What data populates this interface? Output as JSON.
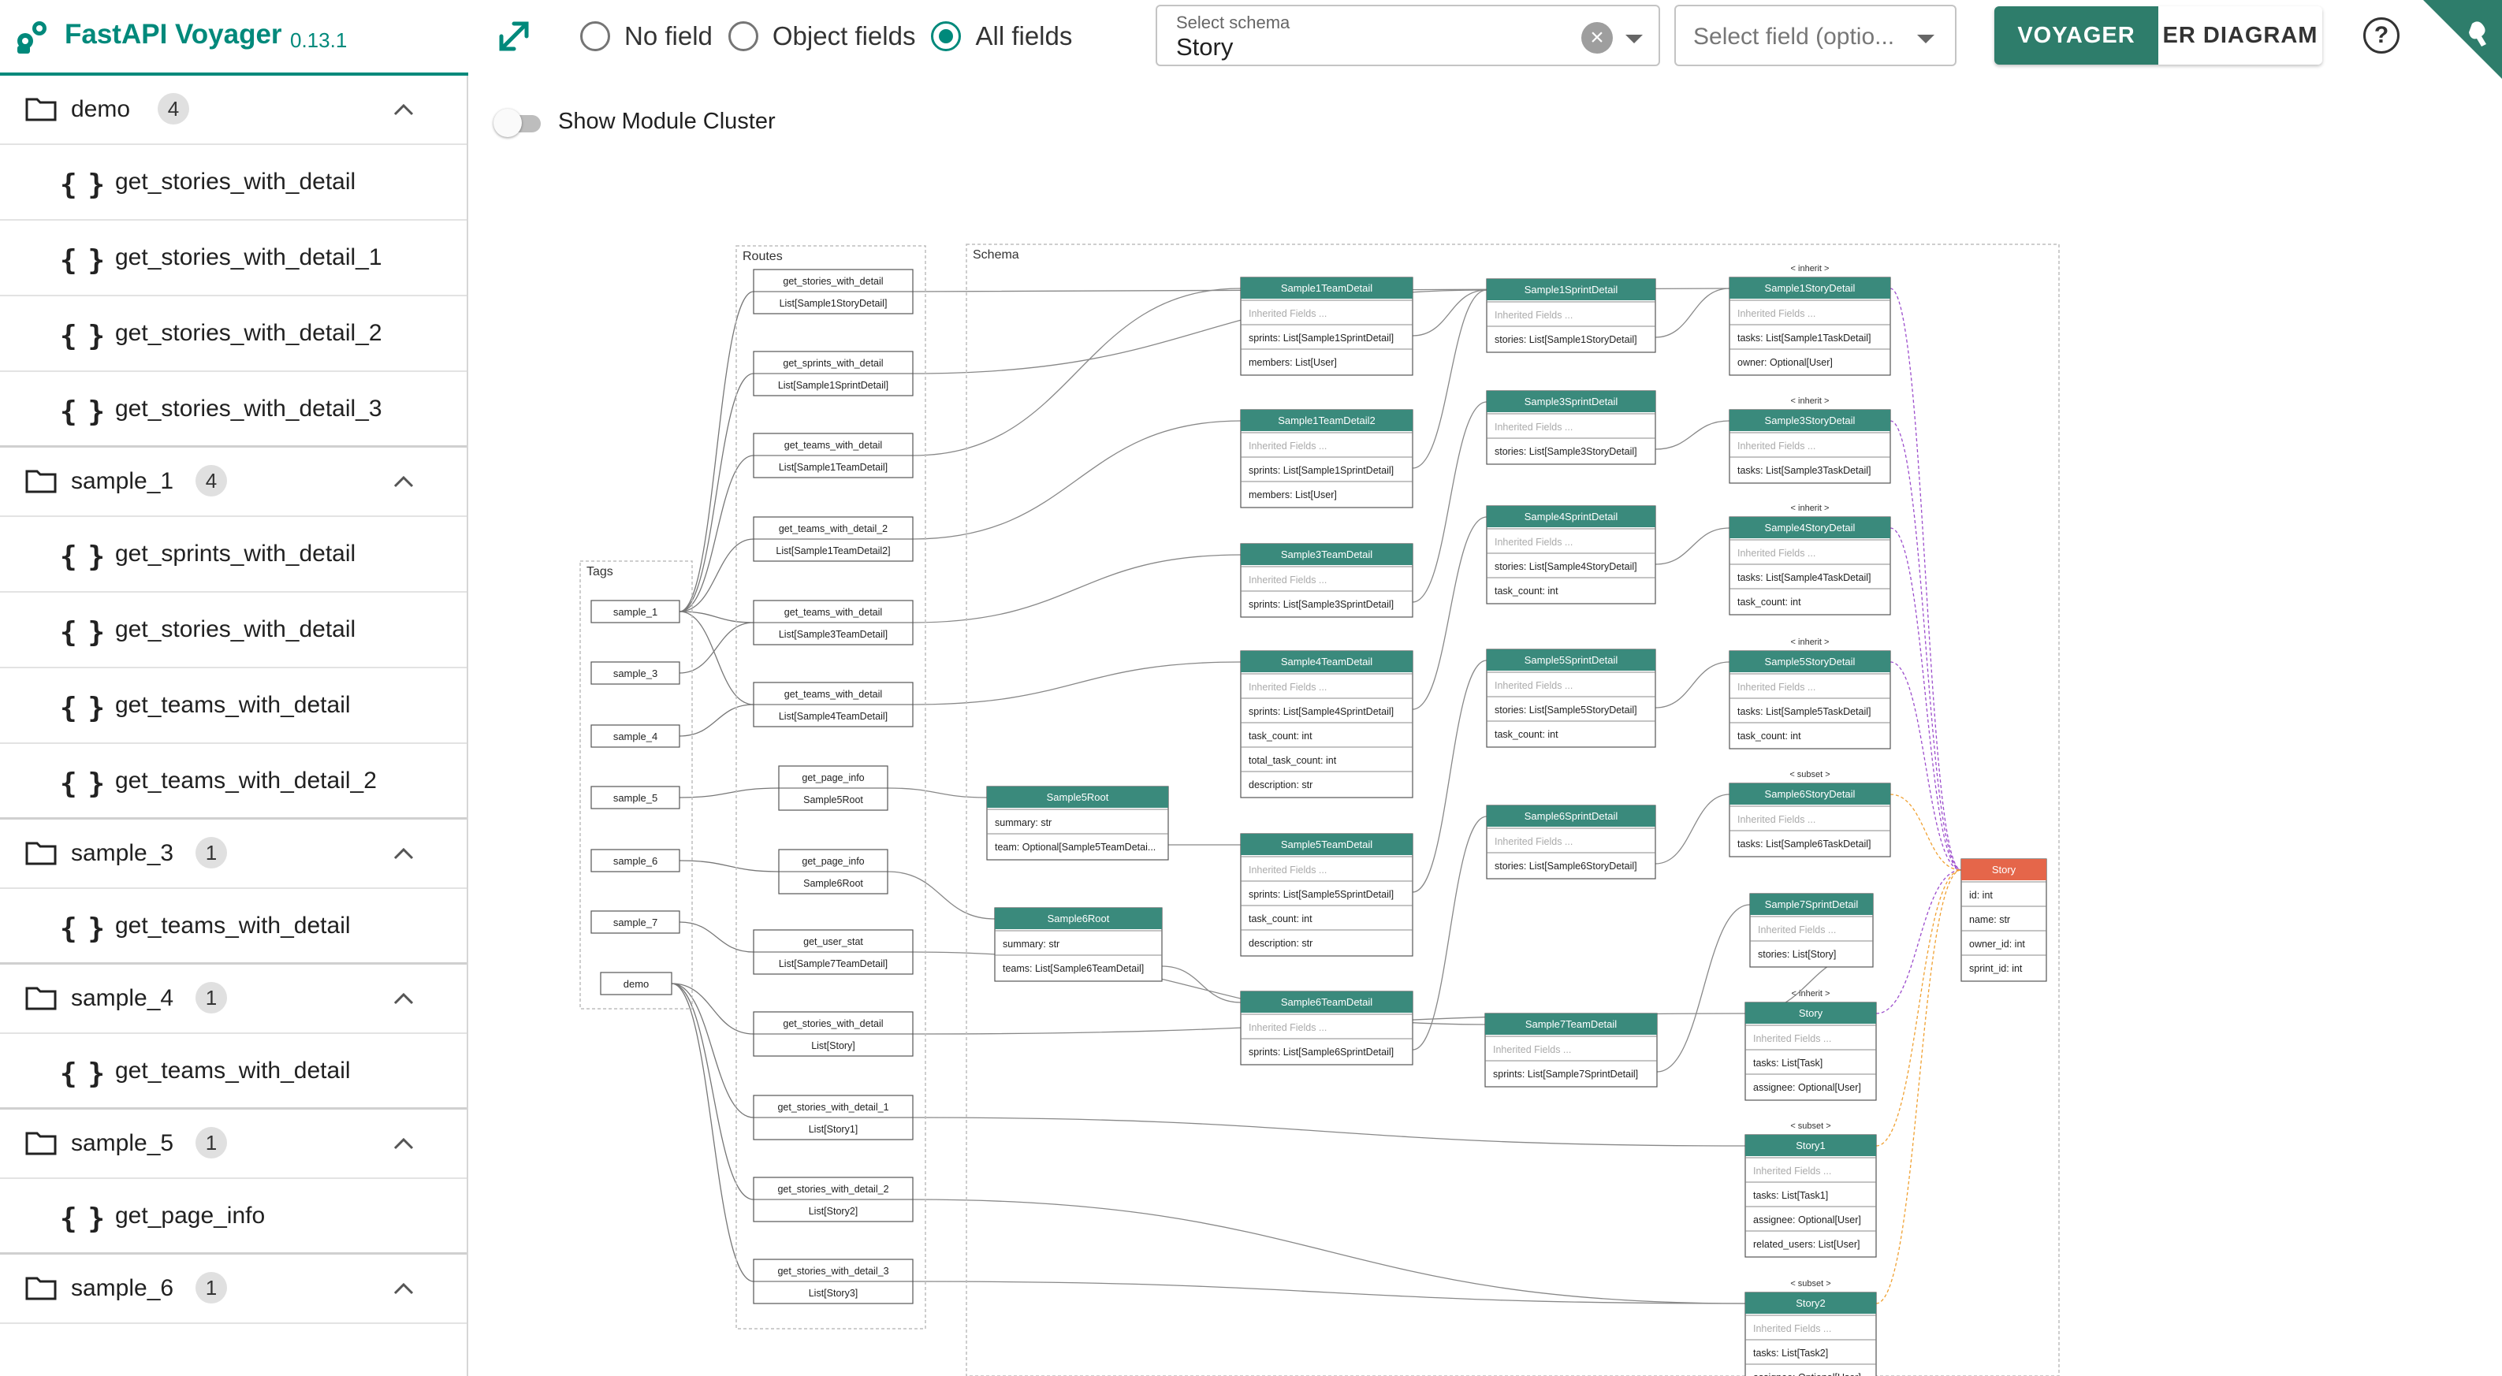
{
  "header": {
    "app_title": "FastAPI Voyager",
    "version": "0.13.1",
    "field_mode_options": [
      "No field",
      "Object fields",
      "All fields"
    ],
    "field_mode_selected": "All fields",
    "schema_select": {
      "label": "Select schema",
      "value": "Story"
    },
    "field_select": {
      "placeholder": "Select field (optio..."
    },
    "view_tabs": [
      {
        "label": "VOYAGER",
        "active": true
      },
      {
        "label": "ER DIAGRAM",
        "active": false
      }
    ],
    "colors": {
      "brand": "#00897b",
      "node_header": "#3a8a7c",
      "target_node": "#e5664a"
    }
  },
  "sidebar": {
    "groups": [
      {
        "name": "demo",
        "count": "4",
        "routes": [
          "get_stories_with_detail",
          "get_stories_with_detail_1",
          "get_stories_with_detail_2",
          "get_stories_with_detail_3"
        ]
      },
      {
        "name": "sample_1",
        "count": "4",
        "routes": [
          "get_sprints_with_detail",
          "get_stories_with_detail",
          "get_teams_with_detail",
          "get_teams_with_detail_2"
        ]
      },
      {
        "name": "sample_3",
        "count": "1",
        "routes": [
          "get_teams_with_detail"
        ]
      },
      {
        "name": "sample_4",
        "count": "1",
        "routes": [
          "get_teams_with_detail"
        ]
      },
      {
        "name": "sample_5",
        "count": "1",
        "routes": [
          "get_page_info"
        ]
      },
      {
        "name": "sample_6",
        "count": "1",
        "routes": []
      }
    ]
  },
  "canvas": {
    "show_module_cluster_label": "Show Module Cluster",
    "clusters": {
      "tags": "Tags",
      "routes": "Routes",
      "schema": "Schema"
    },
    "tags": [
      "sample_1",
      "sample_3",
      "sample_4",
      "sample_5",
      "sample_6",
      "sample_7",
      "demo"
    ],
    "routes": [
      {
        "name": "get_stories_with_detail",
        "ret": "List[Sample1StoryDetail]"
      },
      {
        "name": "get_sprints_with_detail",
        "ret": "List[Sample1SprintDetail]"
      },
      {
        "name": "get_teams_with_detail",
        "ret": "List[Sample1TeamDetail]"
      },
      {
        "name": "get_teams_with_detail_2",
        "ret": "List[Sample1TeamDetail2]"
      },
      {
        "name": "get_teams_with_detail",
        "ret": "List[Sample3TeamDetail]"
      },
      {
        "name": "get_teams_with_detail",
        "ret": "List[Sample4TeamDetail]"
      },
      {
        "name": "get_page_info",
        "ret": "Sample5Root"
      },
      {
        "name": "get_page_info",
        "ret": "Sample6Root"
      },
      {
        "name": "get_user_stat",
        "ret": "List[Sample7TeamDetail]"
      },
      {
        "name": "get_stories_with_detail",
        "ret": "List[Story]"
      },
      {
        "name": "get_stories_with_detail_1",
        "ret": "List[Story1]"
      },
      {
        "name": "get_stories_with_detail_2",
        "ret": "List[Story2]"
      },
      {
        "name": "get_stories_with_detail_3",
        "ret": "List[Story3]"
      }
    ],
    "schemas": [
      {
        "id": "s5root",
        "title": "Sample5Root",
        "fields": [
          "summary: str",
          "team: Optional[Sample5TeamDetai..."
        ]
      },
      {
        "id": "s6root",
        "title": "Sample6Root",
        "fields": [
          "summary: str",
          "teams: List[Sample6TeamDetail]"
        ]
      },
      {
        "id": "t1",
        "title": "Sample1TeamDetail",
        "fields": [
          "Inherited Fields ...",
          "sprints: List[Sample1SprintDetail]",
          "members: List[User]"
        ]
      },
      {
        "id": "t1b",
        "title": "Sample1TeamDetail2",
        "fields": [
          "Inherited Fields ...",
          "sprints: List[Sample1SprintDetail]",
          "members: List[User]"
        ]
      },
      {
        "id": "t3",
        "title": "Sample3TeamDetail",
        "fields": [
          "Inherited Fields ...",
          "sprints: List[Sample3SprintDetail]"
        ]
      },
      {
        "id": "t4",
        "title": "Sample4TeamDetail",
        "fields": [
          "Inherited Fields ...",
          "sprints: List[Sample4SprintDetail]",
          "task_count: int",
          "total_task_count: int",
          "description: str"
        ]
      },
      {
        "id": "t5",
        "title": "Sample5TeamDetail",
        "fields": [
          "Inherited Fields ...",
          "sprints: List[Sample5SprintDetail]",
          "task_count: int",
          "description: str"
        ]
      },
      {
        "id": "t6",
        "title": "Sample6TeamDetail",
        "fields": [
          "Inherited Fields ...",
          "sprints: List[Sample6SprintDetail]"
        ]
      },
      {
        "id": "sp1",
        "title": "Sample1SprintDetail",
        "fields": [
          "Inherited Fields ...",
          "stories: List[Sample1StoryDetail]"
        ]
      },
      {
        "id": "sp3",
        "title": "Sample3SprintDetail",
        "fields": [
          "Inherited Fields ...",
          "stories: List[Sample3StoryDetail]"
        ]
      },
      {
        "id": "sp4",
        "title": "Sample4SprintDetail",
        "fields": [
          "Inherited Fields ...",
          "stories: List[Sample4StoryDetail]",
          "task_count: int"
        ]
      },
      {
        "id": "sp5",
        "title": "Sample5SprintDetail",
        "fields": [
          "Inherited Fields ...",
          "stories: List[Sample5StoryDetail]",
          "task_count: int"
        ]
      },
      {
        "id": "sp6",
        "title": "Sample6SprintDetail",
        "fields": [
          "Inherited Fields ...",
          "stories: List[Sample6StoryDetail]"
        ]
      },
      {
        "id": "sp7t",
        "title": "Sample7TeamDetail",
        "fields": [
          "Inherited Fields ...",
          "sprints: List[Sample7SprintDetail]"
        ]
      },
      {
        "id": "st1",
        "title": "Sample1StoryDetail",
        "fields": [
          "Inherited Fields ...",
          "tasks: List[Sample1TaskDetail]",
          "owner: Optional[User]"
        ],
        "tag": "< inherit >"
      },
      {
        "id": "st3",
        "title": "Sample3StoryDetail",
        "fields": [
          "Inherited Fields ...",
          "tasks: List[Sample3TaskDetail]"
        ],
        "tag": "< inherit >"
      },
      {
        "id": "st4",
        "title": "Sample4StoryDetail",
        "fields": [
          "Inherited Fields ...",
          "tasks: List[Sample4TaskDetail]",
          "task_count: int"
        ],
        "tag": "< inherit >"
      },
      {
        "id": "st5",
        "title": "Sample5StoryDetail",
        "fields": [
          "Inherited Fields ...",
          "tasks: List[Sample5TaskDetail]",
          "task_count: int"
        ],
        "tag": "< inherit >"
      },
      {
        "id": "st6",
        "title": "Sample6StoryDetail",
        "fields": [
          "Inherited Fields ...",
          "tasks: List[Sample6TaskDetail]"
        ],
        "tag": "< subset >"
      },
      {
        "id": "sp7s",
        "title": "Sample7SprintDetail",
        "fields": [
          "Inherited Fields ...",
          "stories: List[Story]"
        ]
      },
      {
        "id": "story",
        "title": "Story",
        "fields": [
          "Inherited Fields ...",
          "tasks: List[Task]",
          "assignee: Optional[User]"
        ],
        "tag": "< inherit >"
      },
      {
        "id": "story1",
        "title": "Story1",
        "fields": [
          "Inherited Fields ...",
          "tasks: List[Task1]",
          "assignee: Optional[User]",
          "related_users: List[User]"
        ],
        "tag": "< subset >"
      },
      {
        "id": "story2",
        "title": "Story2",
        "fields": [
          "Inherited Fields ...",
          "tasks: List[Task2]",
          "assignee: Optional[User]"
        ],
        "tag": "< subset >"
      },
      {
        "id": "target",
        "title": "Story",
        "fields": [
          "id: int",
          "name: str",
          "owner_id: int",
          "sprint_id: int"
        ],
        "target": true
      }
    ]
  }
}
